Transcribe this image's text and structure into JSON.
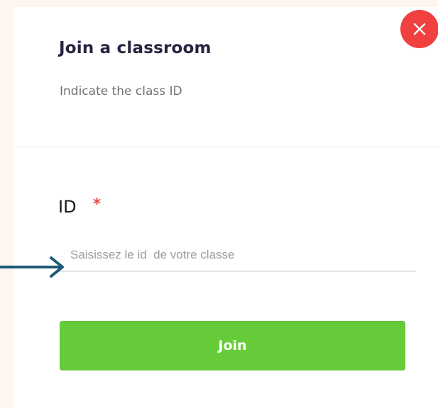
{
  "dialog": {
    "title": "Join a classroom",
    "subtitle": "Indicate the class ID",
    "close_icon": "close-icon"
  },
  "form": {
    "id_label": "ID",
    "required_marker": "*",
    "id_placeholder": "Saisissez le id  de votre classe",
    "id_value": "",
    "join_label": "Join"
  },
  "annotation": {
    "arrow_icon": "arrow-right-icon"
  },
  "colors": {
    "background": "#fdf6ee",
    "accent_green": "#66cb38",
    "close_red": "#f0403f",
    "arrow": "#1c5a78",
    "title": "#2b2240"
  }
}
